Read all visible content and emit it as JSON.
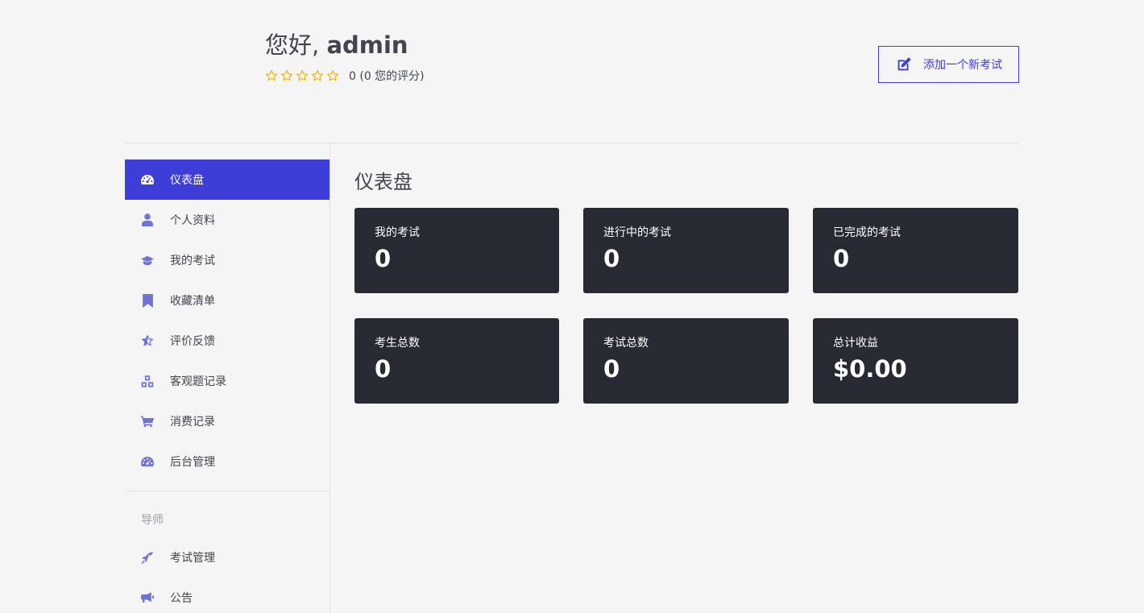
{
  "header": {
    "greeting_prefix": "您好, ",
    "user_name": "admin",
    "rating_text": "0 (0 您的评分)",
    "add_exam_label": "添加一个新考试"
  },
  "colors": {
    "accent": "#3e3dd8",
    "card_bg": "#272933",
    "star": "#f5b300",
    "icon": "#6d74d6"
  },
  "sidebar": {
    "items": [
      {
        "label": "仪表盘",
        "icon": "dashboard-icon",
        "active": true
      },
      {
        "label": "个人资料",
        "icon": "user-icon",
        "active": false
      },
      {
        "label": "我的考试",
        "icon": "graduation-cap-icon",
        "active": false
      },
      {
        "label": "收藏清单",
        "icon": "bookmark-icon",
        "active": false
      },
      {
        "label": "评价反馈",
        "icon": "star-half-icon",
        "active": false
      },
      {
        "label": "客观题记录",
        "icon": "cubes-icon",
        "active": false
      },
      {
        "label": "消费记录",
        "icon": "cart-icon",
        "active": false
      },
      {
        "label": "后台管理",
        "icon": "dashboard-icon",
        "active": false
      }
    ],
    "section_title": "导师",
    "instructor_items": [
      {
        "label": "考试管理",
        "icon": "rocket-icon"
      },
      {
        "label": "公告",
        "icon": "megaphone-icon"
      }
    ]
  },
  "main": {
    "title": "仪表盘",
    "cards": [
      {
        "label": "我的考试",
        "value": "0"
      },
      {
        "label": "进行中的考试",
        "value": "0"
      },
      {
        "label": "已完成的考试",
        "value": "0"
      },
      {
        "label": "考生总数",
        "value": "0"
      },
      {
        "label": "考试总数",
        "value": "0"
      },
      {
        "label": "总计收益",
        "value": "$0.00"
      }
    ]
  }
}
